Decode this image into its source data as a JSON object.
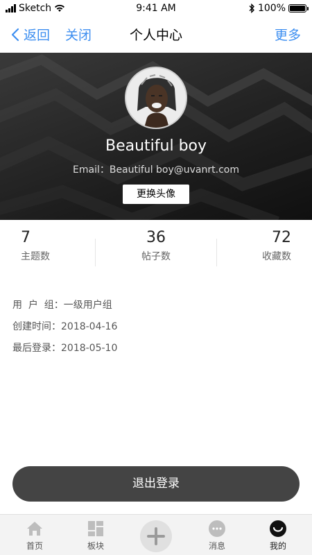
{
  "status_bar": {
    "carrier": "Sketch",
    "time": "9:41 AM",
    "battery_text": "100%",
    "battery_level": 1.0
  },
  "nav": {
    "back_label": "返回",
    "close_label": "关闭",
    "title": "个人中心",
    "more_label": "更多",
    "accent_color": "#3c8ef0"
  },
  "profile": {
    "name": "Beautiful boy",
    "email": "Email：Beautiful boy@uvanrt.com",
    "change_avatar_label": "更换头像"
  },
  "stats": [
    {
      "value": "7",
      "label": "主题数"
    },
    {
      "value": "36",
      "label": "帖子数"
    },
    {
      "value": "72",
      "label": "收藏数"
    }
  ],
  "info": {
    "user_group": "用  户  组：一级用户组",
    "created": "创建时间：2018-04-16",
    "last_login": "最后登录：2018-05-10"
  },
  "logout_label": "退出登录",
  "tabs": [
    {
      "label": "首页",
      "icon": "home-icon"
    },
    {
      "label": "板块",
      "icon": "grid-icon"
    },
    {
      "label": "",
      "icon": "plus-icon"
    },
    {
      "label": "消息",
      "icon": "chat-icon"
    },
    {
      "label": "我的",
      "icon": "profile-icon"
    }
  ]
}
